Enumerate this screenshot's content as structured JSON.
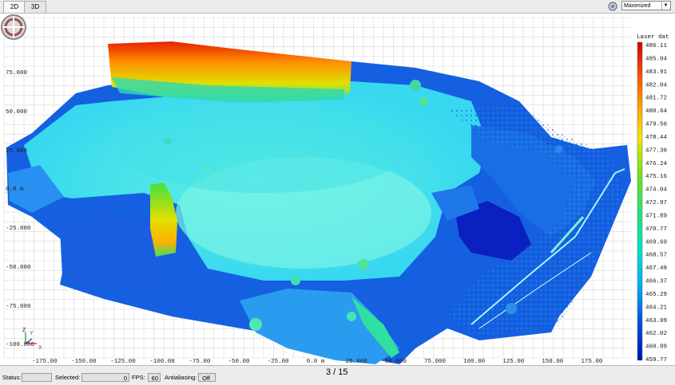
{
  "tabs": {
    "view2d": "2D",
    "view3d": "3D"
  },
  "view_mode": {
    "selected": "Maximized"
  },
  "icons": {
    "logo": "rotation-logo-icon",
    "view": "view-mode-icon",
    "dropdown": "chevron-down-icon",
    "axes": "xyz-axes-icon"
  },
  "plot": {
    "x_ticks": [
      "-175.00",
      "-150.00",
      "-125.00",
      "-100.00",
      "-75.00",
      "-50.00",
      "-25.00",
      "0.0 m",
      "25.000",
      "50.000",
      "75.000",
      "100.00",
      "125.00",
      "150.00",
      "175.00"
    ],
    "y_ticks": [
      "75.000",
      "50.000",
      "25.000",
      "0.0 m",
      "-25.000",
      "-50.000",
      "-75.000",
      "-100.000"
    ],
    "axes": {
      "x": "X",
      "y": "Y",
      "z": "Z"
    }
  },
  "colorbar": {
    "title": "Laser dat",
    "labels": [
      "486.11",
      "485.04",
      "483.91",
      "482.04",
      "481.72",
      "480.64",
      "479.56",
      "478.44",
      "477.36",
      "476.24",
      "475.16",
      "474.04",
      "472.97",
      "471.89",
      "470.77",
      "469.69",
      "468.57",
      "467.49",
      "466.37",
      "465.29",
      "464.21",
      "463.09",
      "462.02",
      "460.89",
      "459.77"
    ],
    "colors": [
      "#d40000",
      "#ff3000",
      "#ff8c00",
      "#ffd000",
      "#b8e000",
      "#30e040",
      "#00e8c8",
      "#00a0f0",
      "#0040e0",
      "#0010b0"
    ]
  },
  "status": {
    "status_label": "Status:",
    "status_value": "",
    "selected_label": "Selected:",
    "selected_value": "0",
    "fps_label": "FPS:",
    "fps_value": "60",
    "antialias_label": "Antialiasing:",
    "antialias_value": "Off",
    "page": "3 / 15"
  }
}
